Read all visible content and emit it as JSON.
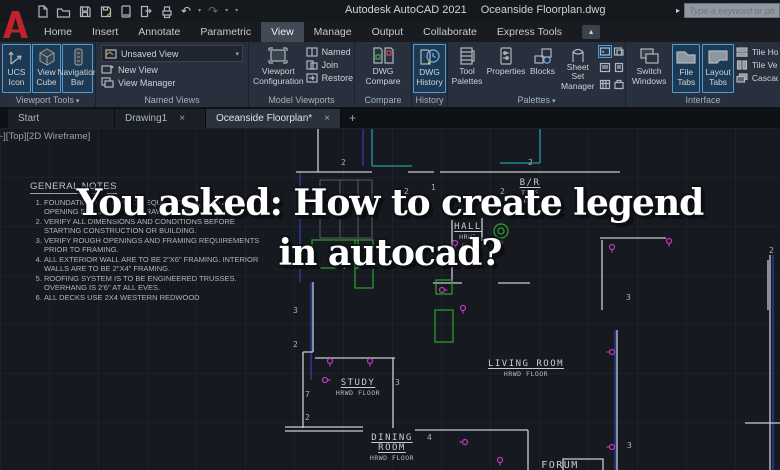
{
  "glyphs": {
    "caret_down": "▾",
    "caret_right": "▸",
    "close": "×",
    "add": "+",
    "undo": "↶",
    "redo": "↷",
    "collapse": "▲"
  },
  "titlebar": {
    "app_name": "Autodesk AutoCAD 2021",
    "doc_name": "Oceanside Floorplan.dwg",
    "search_placeholder": "Type a keyword or phrase"
  },
  "tabs": {
    "items": [
      "Home",
      "Insert",
      "Annotate",
      "Parametric",
      "View",
      "Manage",
      "Output",
      "Collaborate",
      "Express Tools"
    ]
  },
  "ribbon": {
    "vt": {
      "title": "Viewport Tools",
      "b0l1": "UCS",
      "b0l2": "Icon",
      "b1l1": "View",
      "b1l2": "Cube",
      "b2l1": "Navigation",
      "b2l2": "Bar"
    },
    "nv": {
      "title": "Named Views",
      "combo": "Unsaved View",
      "new_view": "New View",
      "view_manager": "View Manager"
    },
    "mv": {
      "title": "Model Viewports",
      "cfg1": "Viewport",
      "cfg2": "Configuration",
      "named": "Named",
      "join": "Join",
      "restore": "Restore"
    },
    "cmp": {
      "title": "Compare",
      "l1": "DWG",
      "l2": "Compare"
    },
    "hist": {
      "title": "History",
      "l1": "DWG",
      "l2": "History"
    },
    "pal": {
      "title": "Palettes",
      "tool1": "Tool",
      "tool2": "Palettes",
      "properties": "Properties",
      "blocks": "Blocks",
      "ssm1": "Sheet Set",
      "ssm2": "Manager"
    },
    "intf": {
      "title": "Interface",
      "sw1": "Switch",
      "sw2": "Windows",
      "ft1": "File",
      "ft2": "Tabs",
      "lt1": "Layout",
      "lt2": "Tabs",
      "tile_h": "Tile Horizontally",
      "tile_v": "Tile Vertically",
      "cascade": "Cascade"
    }
  },
  "doc_tabs": {
    "start": "Start",
    "drawing1": "Drawing1",
    "active": "Oceanside Floorplan*"
  },
  "canvas": {
    "viewport_label": "-][Top][2D Wireframe]",
    "numbers": [
      "2",
      "1",
      "2",
      "2",
      "2",
      "2",
      "3",
      "3",
      "2",
      "7",
      "2",
      "3",
      "4",
      "3"
    ]
  },
  "notes": {
    "title": "GENERAL NOTES",
    "items": [
      "FOUNDATION VENTILATION EQUIV. TO 1 SQ. FT. NET OPENING PER 150 S.F. OF CRAWL SPACE.",
      "VERIFY ALL DIMENSIONS AND CONDITIONS BEFORE STARTING CONSTRUCTION OR BUILDING.",
      "VERIFY ROUGH OPENINGS AND FRAMING REQUIREMENTS PRIOR TO FRAMING.",
      "ALL EXTERIOR WALL ARE TO BE 2\"X6\" FRAMING. INTERIOR WALLS ARE TO BE 2\"X4\" FRAMING.",
      "ROOFING SYSTEM IS TO BE ENGINEERED TRUSSES. OVERHANG IS 2'6\" AT ALL EVES.",
      "ALL DECKS USE 2X4 WESTERN REDWOOD"
    ]
  },
  "rooms": {
    "br": {
      "name": "B/R",
      "sub1": "TILE",
      "sub2": "FL."
    },
    "hall": {
      "name": "HALL",
      "sub1": "HRWD",
      "sub2": "FL."
    },
    "living": {
      "name": "LIVING ROOM",
      "sub1": "HRWD FLOOR"
    },
    "study": {
      "name": "STUDY",
      "sub1": "HRWD FLOOR"
    },
    "dining": {
      "l1": "DINING",
      "l2": "ROOM",
      "sub1": "HRWD FLOOR"
    },
    "forum": {
      "name": "FORUM"
    }
  },
  "headline": {
    "line1": "You asked: How to create legend",
    "line2": "in autocad?"
  }
}
